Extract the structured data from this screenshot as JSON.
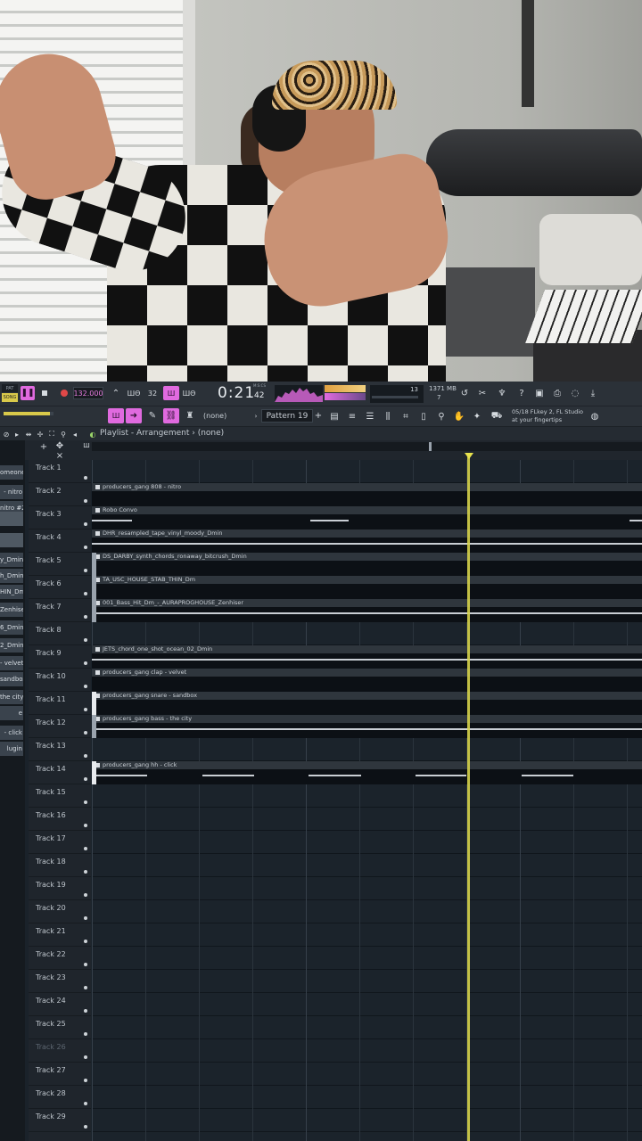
{
  "toolbar": {
    "pat_song": [
      "PAT",
      "SONG"
    ],
    "tempo": "132.000",
    "time_sig": "32",
    "time": "0:21",
    "time_sub": "42",
    "time_unit": "M:S:CS",
    "cpu_value": "13",
    "memory": "1371 MB",
    "voices": "7",
    "pattern_none": "(none)",
    "pattern_name": "Pattern 19",
    "hint_line1": "05/18  FLkey 2, FL Studio",
    "hint_line2": "at your fingertips"
  },
  "playlist": {
    "title": "Playlist - Arrangement",
    "breadcrumb": "(none)"
  },
  "picker": [
    "omeone",
    "- nitro",
    "nitro #2",
    "",
    "",
    "y_Dmin",
    "h_Dmin",
    "HIN_Dm",
    "Zenhiser",
    "6_Dmin",
    "2_Dmin",
    "- velvet",
    "sandbox",
    "the city",
    "e",
    "- click",
    "lugin"
  ],
  "tracks": [
    "Track 1",
    "Track 2",
    "Track 3",
    "Track 4",
    "Track 5",
    "Track 6",
    "Track 7",
    "Track 8",
    "Track 9",
    "Track 10",
    "Track 11",
    "Track 12",
    "Track 13",
    "Track 14",
    "Track 15",
    "Track 16",
    "Track 17",
    "Track 18",
    "Track 19",
    "Track 20",
    "Track 21",
    "Track 22",
    "Track 23",
    "Track 24",
    "Track 25",
    "Track 26",
    "Track 27",
    "Track 28",
    "Track 29"
  ],
  "clips": [
    {
      "track": 2,
      "name": "producers_gang 808 - nitro"
    },
    {
      "track": 3,
      "name": "Robo Convo"
    },
    {
      "track": 4,
      "name": "DHR_resampled_tape_vinyl_moody_Dmin"
    },
    {
      "track": 5,
      "name": "DS_DARBY_synth_chords_ronaway_bitcrush_Dmin"
    },
    {
      "track": 6,
      "name": "TA_USC_HOUSE_STAB_THIN_Dm"
    },
    {
      "track": 7,
      "name": "001_Bass_Hit_Dm_-_AURAPROGHOUSE_Zenhiser"
    },
    {
      "track": 9,
      "name": "JETS_chord_one_shot_ocean_02_Dmin"
    },
    {
      "track": 10,
      "name": "producers_gang clap - velvet"
    },
    {
      "track": 11,
      "name": "producers_gang snare - sandbox"
    },
    {
      "track": 12,
      "name": "producers_gang bass - the city"
    },
    {
      "track": 14,
      "name": "producers_gang hh - click"
    }
  ],
  "colors": {
    "accent": "#e06adf",
    "playhead": "#d6d34a"
  }
}
